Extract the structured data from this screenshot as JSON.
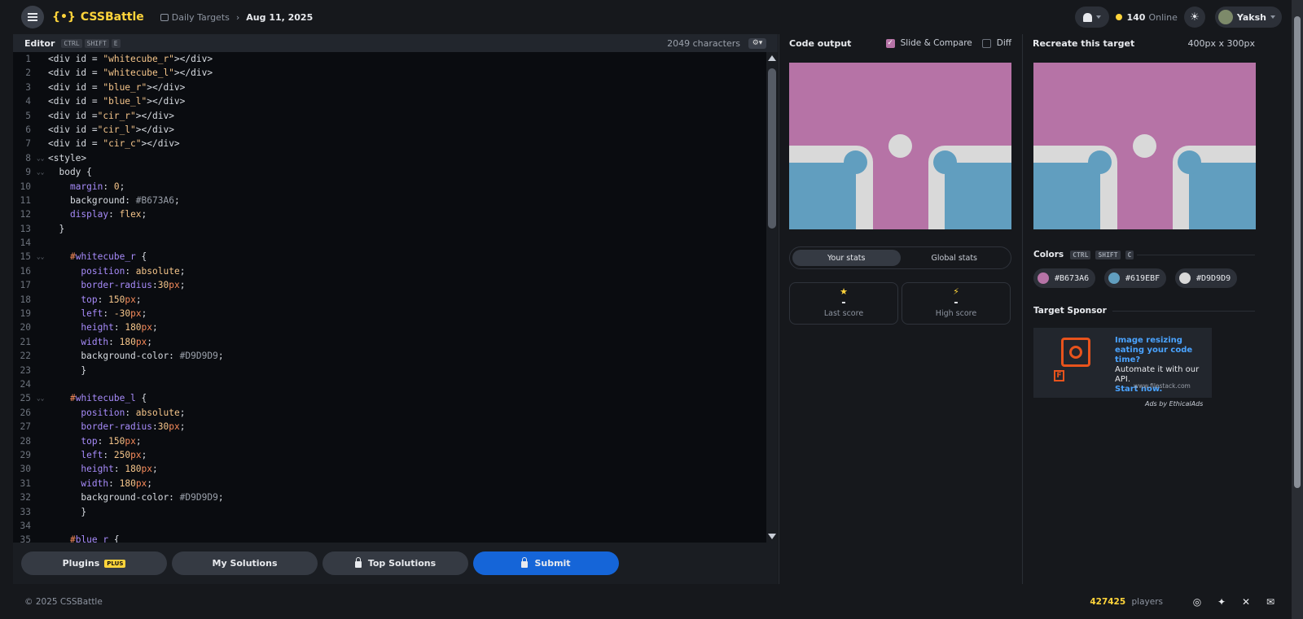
{
  "header": {
    "logo_mark": "{•}",
    "logo_text": "CSSBattle",
    "breadcrumb_parent": "Daily Targets",
    "breadcrumb_current": "Aug 11, 2025",
    "online_count": "140",
    "online_label": "Online",
    "username": "Yaksh"
  },
  "editor": {
    "title": "Editor",
    "shortcut": [
      "CTRL",
      "SHIFT",
      "E"
    ],
    "char_count": "2049 characters",
    "lines": [
      "<div id = \"whitecube_r\"></div>",
      "<div id = \"whitecube_l\"></div>",
      "<div id = \"blue_r\"></div>",
      "<div id = \"blue_l\"></div>",
      "<div id =\"cir_r\"></div>",
      "<div id =\"cir_l\"></div>",
      "<div id = \"cir_c\"></div>",
      "<style>",
      "  body {",
      "    margin: 0;",
      "    background: #B673A6;",
      "    display: flex;",
      "  }",
      "",
      "    #whitecube_r {",
      "      position: absolute;",
      "      border-radius:30px;",
      "      top: 150px;",
      "      left: -30px;",
      "      height: 180px;",
      "      width: 180px;",
      "      background-color: #D9D9D9;",
      "      }",
      "",
      "    #whitecube_l {",
      "      position: absolute;",
      "      border-radius:30px;",
      "      top: 150px;",
      "      left: 250px;",
      "      height: 180px;",
      "      width: 180px;",
      "      background-color: #D9D9D9;",
      "      }",
      "",
      "    #blue_r {"
    ],
    "fold_lines": [
      8,
      9,
      15,
      25
    ]
  },
  "footer_buttons": {
    "plugins": "Plugins",
    "plugins_badge": "PLUS",
    "my_solutions": "My Solutions",
    "top_solutions": "Top Solutions",
    "submit": "Submit"
  },
  "output": {
    "title": "Code output",
    "slide_compare": "Slide & Compare",
    "diff": "Diff",
    "tab_your": "Your stats",
    "tab_global": "Global stats",
    "last_score_value": "-",
    "last_score_label": "Last score",
    "high_score_value": "-",
    "high_score_label": "High score"
  },
  "target": {
    "title": "Recreate this target",
    "size": "400px x 300px",
    "colors_label": "Colors",
    "colors_shortcut": [
      "CTRL",
      "SHIFT",
      "C"
    ],
    "colors": [
      {
        "hex": "#B673A6",
        "label": "#B673A6"
      },
      {
        "hex": "#619EBF",
        "label": "#619EBF"
      },
      {
        "hex": "#D9D9D9",
        "label": "#D9D9D9"
      }
    ],
    "sponsor_label": "Target Sponsor",
    "ad_headline": "Image resizing eating your code time?",
    "ad_body": "Automate it with our API.",
    "ad_cta": "Start now.",
    "ad_domain": "www.filestack.com",
    "ad_by": "Ads by EthicalAds"
  },
  "footer": {
    "copyright": "© 2025 CSSBattle",
    "players_count": "427425",
    "players_label": "players"
  },
  "colors": {
    "pink": "#B673A6",
    "blue": "#619EBF",
    "grey": "#D9D9D9",
    "accent": "#FFD43B",
    "submit": "#1565D8"
  }
}
